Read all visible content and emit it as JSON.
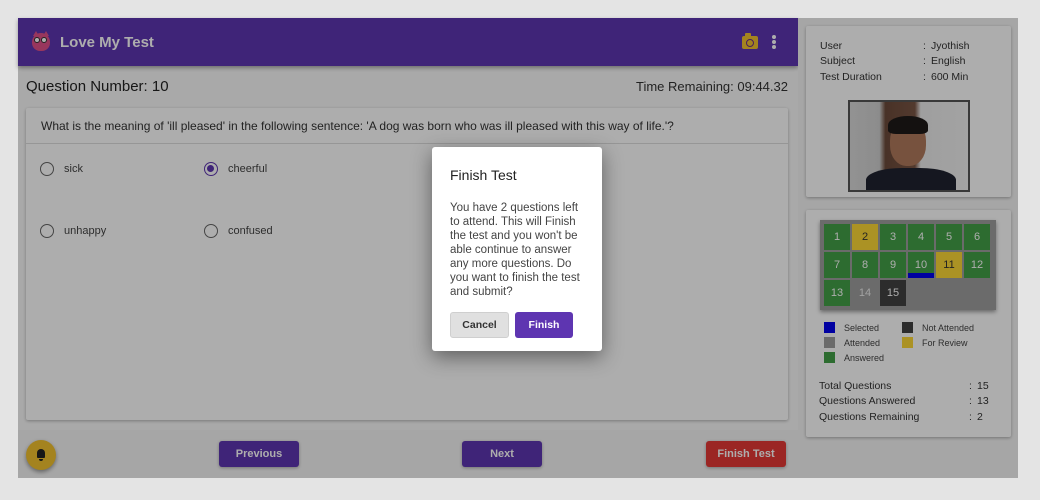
{
  "appbar": {
    "title": "Love My Test",
    "icons": [
      "owl-logo-icon",
      "camera-icon",
      "more-vert-icon"
    ]
  },
  "question": {
    "number_label": "Question Number: 10",
    "time_remaining": "Time Remaining: 09:44.32",
    "text": "What is the meaning of 'ill pleased' in the following sentence: 'A dog was born who was ill pleased with this way of life.'?",
    "options": [
      {
        "label": "sick",
        "checked": false
      },
      {
        "label": "cheerful",
        "checked": true
      },
      {
        "label": "unhappy",
        "checked": false
      },
      {
        "label": "confused",
        "checked": false
      }
    ]
  },
  "footer": {
    "bell_icon": "bell-icon",
    "previous_label": "Previous",
    "next_label": "Next",
    "finish_label": "Finish Test"
  },
  "info": {
    "rows": [
      {
        "key": "User",
        "value": "Jyothish"
      },
      {
        "key": "Subject",
        "value": "English"
      },
      {
        "key": "Test Duration",
        "value": "600 Min"
      }
    ],
    "separator": ":"
  },
  "palette": {
    "questions": [
      {
        "n": "1",
        "status": "answered"
      },
      {
        "n": "2",
        "status": "review"
      },
      {
        "n": "3",
        "status": "answered"
      },
      {
        "n": "4",
        "status": "answered"
      },
      {
        "n": "5",
        "status": "answered"
      },
      {
        "n": "6",
        "status": "answered"
      },
      {
        "n": "7",
        "status": "answered"
      },
      {
        "n": "8",
        "status": "answered"
      },
      {
        "n": "9",
        "status": "answered"
      },
      {
        "n": "10",
        "status": "answered",
        "selected": true
      },
      {
        "n": "11",
        "status": "review"
      },
      {
        "n": "12",
        "status": "answered"
      },
      {
        "n": "13",
        "status": "answered"
      },
      {
        "n": "14",
        "status": "attended"
      },
      {
        "n": "15",
        "status": "notattended"
      }
    ],
    "legend": [
      {
        "label": "Selected",
        "color": "#0000ee"
      },
      {
        "label": "Not Attended",
        "color": "#424242"
      },
      {
        "label": "Attended",
        "color": "#9e9e9e"
      },
      {
        "label": "For Review",
        "color": "#fdd835"
      },
      {
        "label": "Answered",
        "color": "#43a047"
      }
    ]
  },
  "stats": {
    "rows": [
      {
        "key": "Total Questions",
        "value": "15"
      },
      {
        "key": "Questions Answered",
        "value": "13"
      },
      {
        "key": "Questions Remaining",
        "value": "2"
      }
    ]
  },
  "dialog": {
    "title": "Finish Test",
    "body": "You have 2 questions left to attend. This will Finish the test and you won't be able continue to answer any more questions. Do you want to finish the test and submit?",
    "cancel_label": "Cancel",
    "finish_label": "Finish"
  },
  "colors": {
    "primary": "#5e35b1",
    "danger": "#e53935",
    "accent": "#fdd835",
    "answered": "#43a047"
  }
}
